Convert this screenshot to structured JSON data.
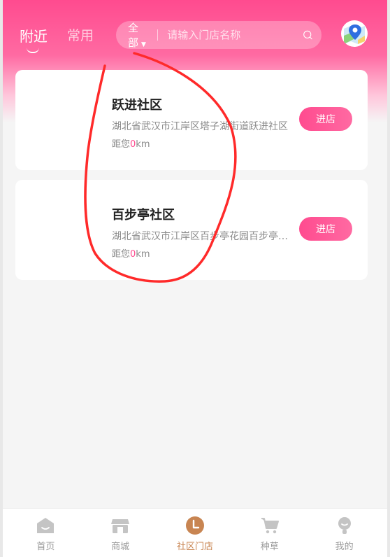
{
  "header": {
    "tabs": [
      {
        "label": "附近",
        "active": true
      },
      {
        "label": "常用",
        "active": false
      }
    ],
    "search": {
      "filter_label": "全部",
      "placeholder": "请输入门店名称"
    },
    "map_icon": "map-location-icon"
  },
  "stores": [
    {
      "name": "跃进社区",
      "address": "湖北省武汉市江岸区塔子湖街道跃进社区",
      "distance_prefix": "距您",
      "distance_value": "0",
      "distance_unit": "km",
      "button_label": "进店"
    },
    {
      "name": "百步亭社区",
      "address": "湖北省武汉市江岸区百步亭花园百步亭社区",
      "distance_prefix": "距您",
      "distance_value": "0",
      "distance_unit": "km",
      "button_label": "进店"
    }
  ],
  "tabbar": [
    {
      "label": "首页",
      "icon": "home-icon",
      "active": false
    },
    {
      "label": "商城",
      "icon": "shop-icon",
      "active": false
    },
    {
      "label": "社区门店",
      "icon": "community-store-icon",
      "active": true
    },
    {
      "label": "种草",
      "icon": "cart-icon",
      "active": false
    },
    {
      "label": "我的",
      "icon": "profile-icon",
      "active": false
    }
  ],
  "colors": {
    "brand_pink": "#ff4b8f",
    "active_tab": "#c88552",
    "inactive_tab": "#bdbdbd",
    "annotation_red": "#ff2a2a"
  }
}
